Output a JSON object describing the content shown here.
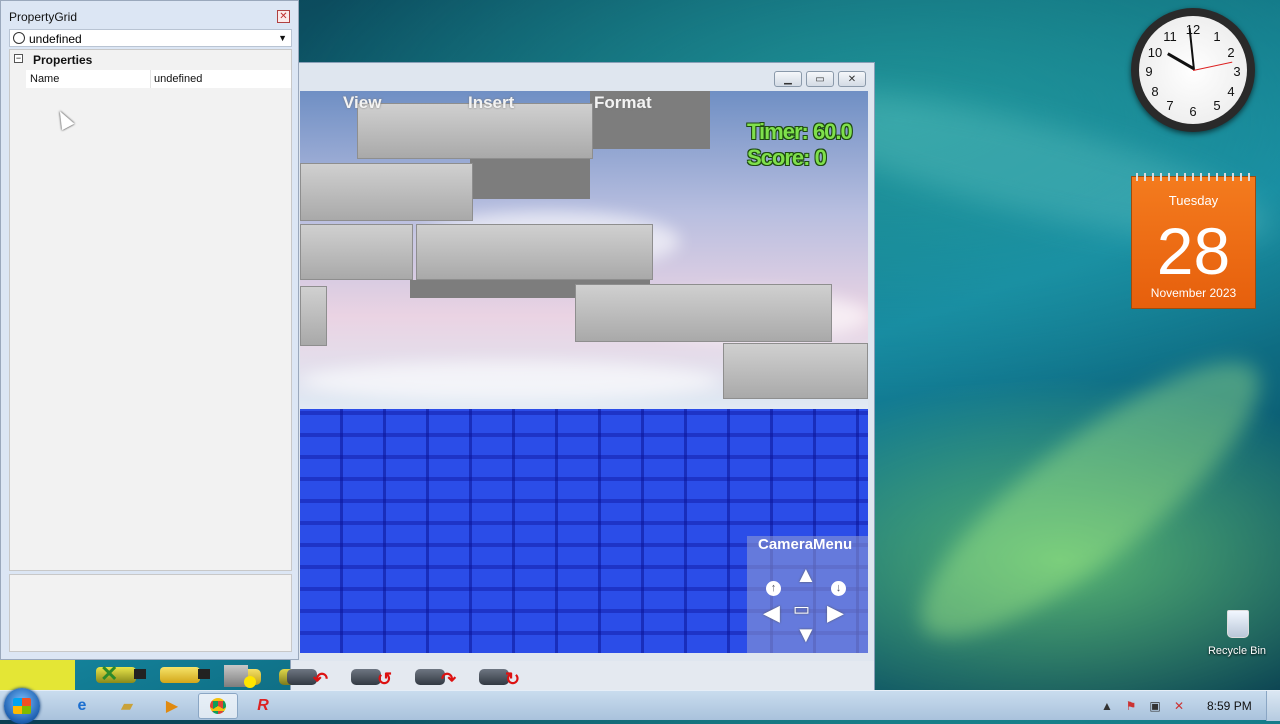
{
  "property_grid": {
    "title": "PropertyGrid",
    "selected_object": "undefined",
    "category": "Properties",
    "rows": [
      {
        "name": "Name",
        "value": "undefined"
      }
    ]
  },
  "game": {
    "menu": [
      "View",
      "Insert",
      "Format"
    ],
    "hud": {
      "timer": "Timer: 60.0",
      "score": "Score: 0"
    },
    "camera_menu": {
      "title": "CameraMenu"
    }
  },
  "calendar": {
    "day": "Tuesday",
    "date": "28",
    "month_year": "November 2023"
  },
  "clock": {
    "numbers": [
      "12",
      "1",
      "2",
      "3",
      "4",
      "5",
      "6",
      "7",
      "8",
      "9",
      "10",
      "11"
    ]
  },
  "desktop": {
    "recycle_bin": "Recycle Bin"
  },
  "taskbar": {
    "time": "8:59 PM"
  },
  "colors": {
    "floor": "#2b4de8",
    "calendar": "#f47b1e",
    "hud_text": "#7fe04c"
  }
}
